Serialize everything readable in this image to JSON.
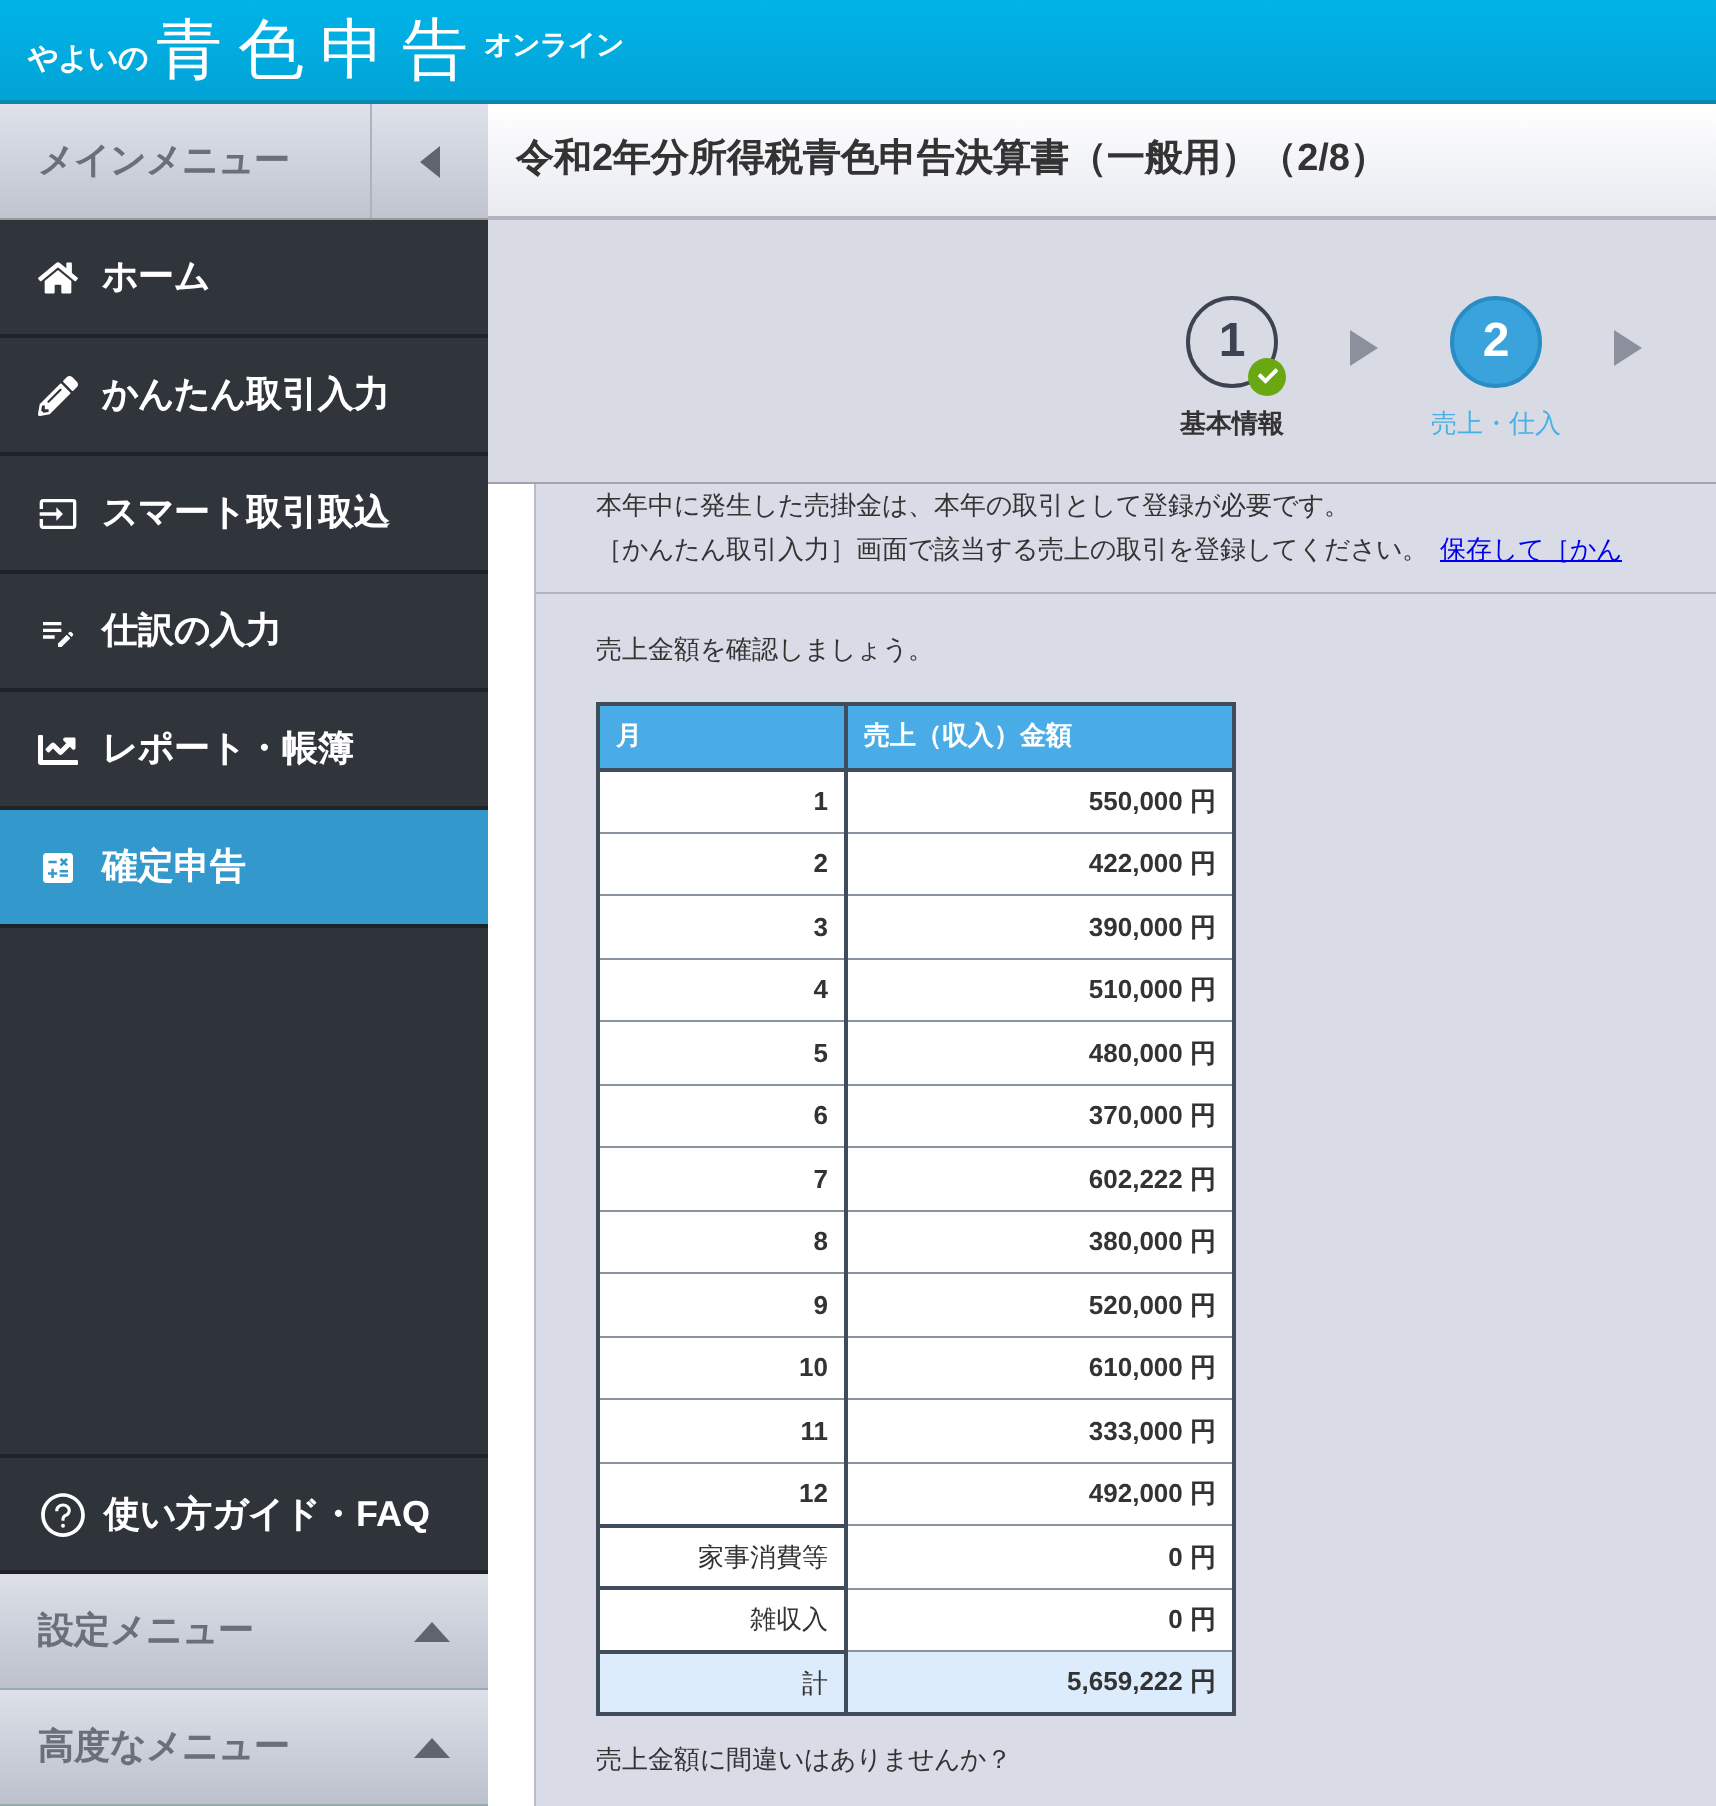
{
  "header": {
    "logo_prefix": "やよいの",
    "logo_main": "青色申告",
    "logo_suffix": "オンライン"
  },
  "sidebar": {
    "title": "メインメニュー",
    "items": [
      {
        "kind": "home",
        "label": "ホーム",
        "selected": false
      },
      {
        "kind": "pencil",
        "label": "かんたん取引入力",
        "selected": false
      },
      {
        "kind": "import",
        "label": "スマート取引取込",
        "selected": false
      },
      {
        "kind": "journal",
        "label": "仕訳の入力",
        "selected": false
      },
      {
        "kind": "report",
        "label": "レポート・帳簿",
        "selected": false
      },
      {
        "kind": "tax",
        "label": "確定申告",
        "selected": true
      }
    ],
    "guide": "使い方ガイド・FAQ",
    "sections": [
      {
        "label": "設定メニュー",
        "expanded": false
      },
      {
        "label": "高度なメニュー",
        "expanded": false
      }
    ]
  },
  "page_title": "令和2年分所得税青色申告決算書（一般用）（2/8）",
  "steps": [
    {
      "number": "1",
      "label": "基本情報",
      "done": true,
      "selected": false
    },
    {
      "number": "2",
      "label": "売上・仕入",
      "done": false,
      "selected": true
    }
  ],
  "notice": {
    "line_1": "本年中に発生した売掛金は、本年の取引として登録が必要です。",
    "line_2": "［かんたん取引入力］画面で該当する売上の取引を登録してください。",
    "link": "保存して［かん"
  },
  "prompt": "売上金額を確認しましょう。",
  "table": {
    "columns": [
      "月",
      "売上（収入）金額"
    ],
    "rows": [
      {
        "kind": "month",
        "label": "1",
        "amount": "550,000 円"
      },
      {
        "kind": "month",
        "label": "2",
        "amount": "422,000 円"
      },
      {
        "kind": "month",
        "label": "3",
        "amount": "390,000 円"
      },
      {
        "kind": "month",
        "label": "4",
        "amount": "510,000 円"
      },
      {
        "kind": "month",
        "label": "5",
        "amount": "480,000 円"
      },
      {
        "kind": "month",
        "label": "6",
        "amount": "370,000 円"
      },
      {
        "kind": "month",
        "label": "7",
        "amount": "602,222 円"
      },
      {
        "kind": "month",
        "label": "8",
        "amount": "380,000 円"
      },
      {
        "kind": "month",
        "label": "9",
        "amount": "520,000 円"
      },
      {
        "kind": "month",
        "label": "10",
        "amount": "610,000 円"
      },
      {
        "kind": "month",
        "label": "11",
        "amount": "333,000 円"
      },
      {
        "kind": "month",
        "label": "12",
        "amount": "492,000 円"
      },
      {
        "kind": "other",
        "label": "家事消費等",
        "amount": "0 円"
      },
      {
        "kind": "other",
        "label": "雑収入",
        "amount": "0 円"
      },
      {
        "kind": "total",
        "label": "計",
        "amount": "5,659,222 円"
      }
    ]
  },
  "question": "売上金額に間違いはありませんか？"
}
